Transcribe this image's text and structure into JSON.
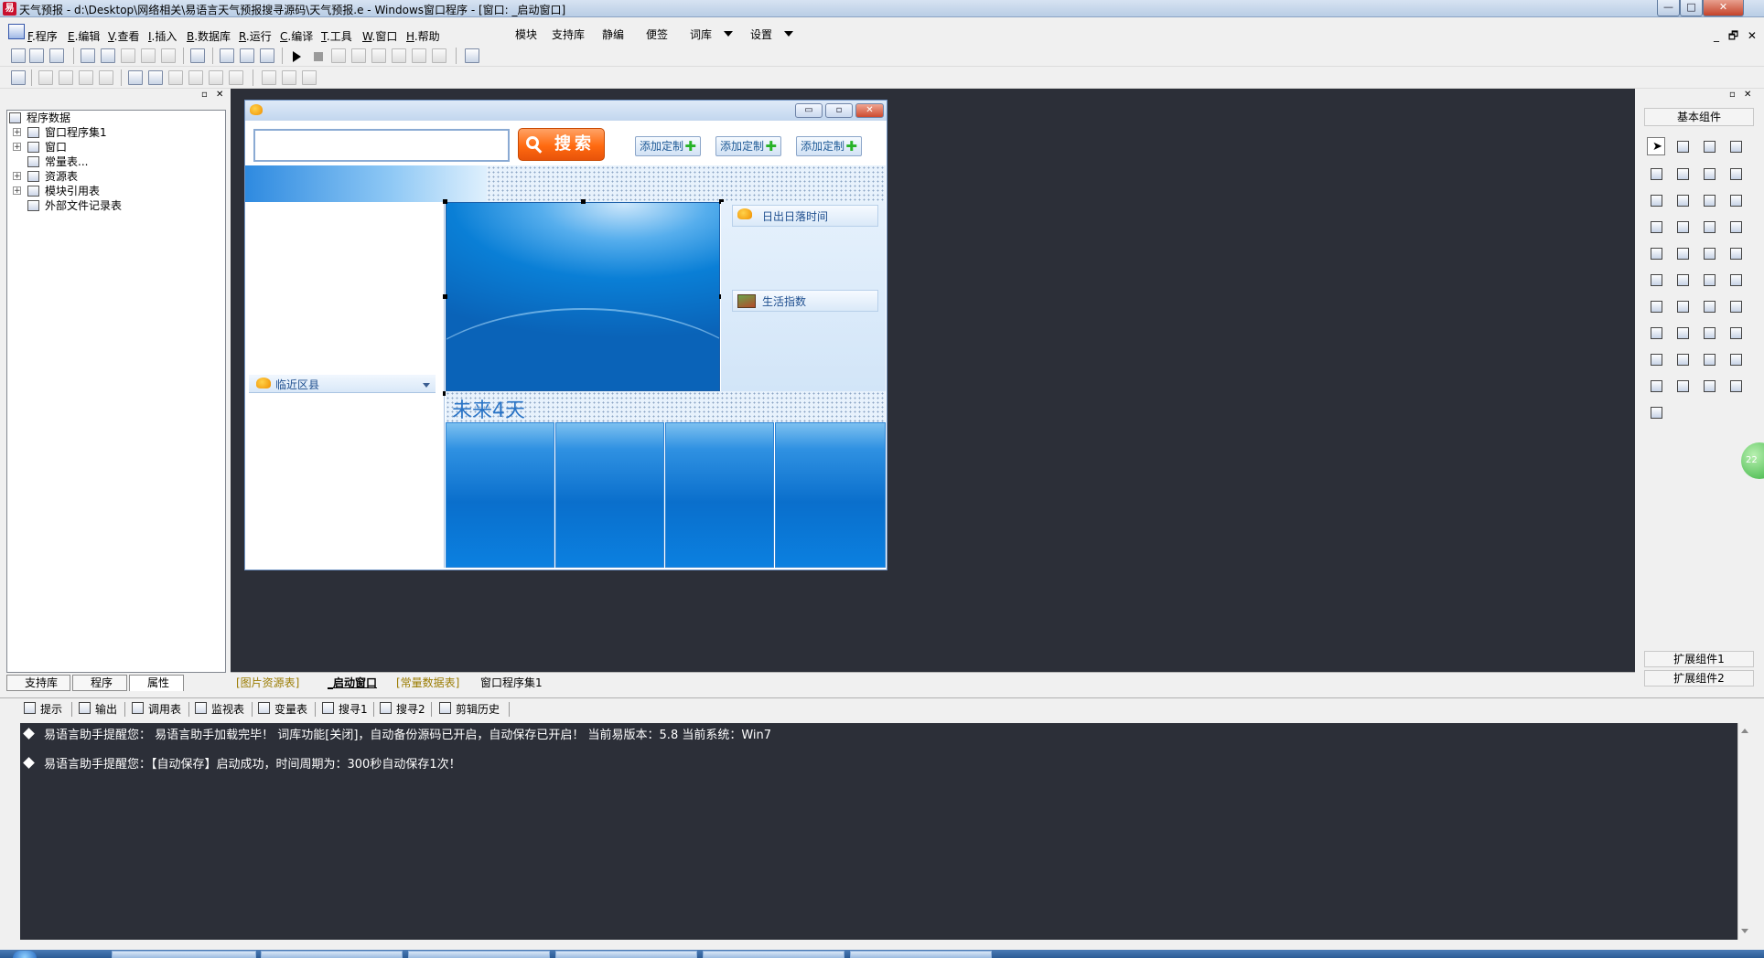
{
  "titlebar": {
    "title": "天气预报 - d:\\Desktop\\网络相关\\易语言天气预报搜寻源码\\天气预报.e - Windows窗口程序 - [窗口: _启动窗口]",
    "icon_text": "易",
    "min": "—",
    "max": "□",
    "close": "✕"
  },
  "menu": {
    "items": [
      {
        "key": "F",
        "label": ".程序"
      },
      {
        "key": "E",
        "label": ".编辑"
      },
      {
        "key": "V",
        "label": ".查看"
      },
      {
        "key": "I",
        "label": ".插入"
      },
      {
        "key": "B",
        "label": ".数据库"
      },
      {
        "key": "R",
        "label": ".运行"
      },
      {
        "key": "C",
        "label": ".编译"
      },
      {
        "key": "T",
        "label": ".工具"
      },
      {
        "key": "W",
        "label": ".窗口"
      },
      {
        "key": "H",
        "label": ".帮助"
      }
    ],
    "extra": [
      "模块",
      "支持库",
      "静编",
      "便签",
      "词库",
      "设置"
    ],
    "mdi_controls": "_ 🗗 ✕"
  },
  "left_panel": {
    "header_buttons": "▫ ✕",
    "tree_root": "程序数据",
    "tree_items": [
      "窗口程序集1",
      "窗口",
      "常量表...",
      "资源表",
      "模块引用表",
      "外部文件记录表"
    ],
    "tabs": [
      "支持库",
      "程序",
      "属性"
    ]
  },
  "form": {
    "buttons": {
      "min": "▭",
      "max": "▫",
      "close": "✕"
    },
    "search_label": "搜索",
    "add_buttons": [
      "添加定制",
      "添加定制",
      "添加定制"
    ],
    "plus": "✚",
    "sunrise_label": "日出日落时间",
    "life_index_label": "生活指数",
    "nearby_label": "临近区县",
    "future_label": "未来4天"
  },
  "doc_tabs": [
    "[图片资源表]",
    "_启动窗口",
    "[常量数据表]",
    "窗口程序集1"
  ],
  "toolbox": {
    "header_buttons": "▫ ✕",
    "title": "基本组件",
    "ext1": "扩展组件1",
    "ext2": "扩展组件2",
    "badge": "22"
  },
  "output_tabs": [
    "提示",
    "输出",
    "调用表",
    "监视表",
    "变量表",
    "搜寻1",
    "搜寻2",
    "剪辑历史"
  ],
  "output_lines": [
    "易语言助手提醒您： 易语言助手加载完毕！ 词库功能[关闭]，自动备份源码已开启，自动保存已开启！ 当前易版本：5.8  当前系统：Win7",
    "易语言助手提醒您：【自动保存】启动成功，时间周期为：300秒自动保存1次！"
  ],
  "colors": {
    "design_bg": "#2c2f38",
    "search_orange": "#ff6a10",
    "form_blue": "#0a7fd6"
  }
}
